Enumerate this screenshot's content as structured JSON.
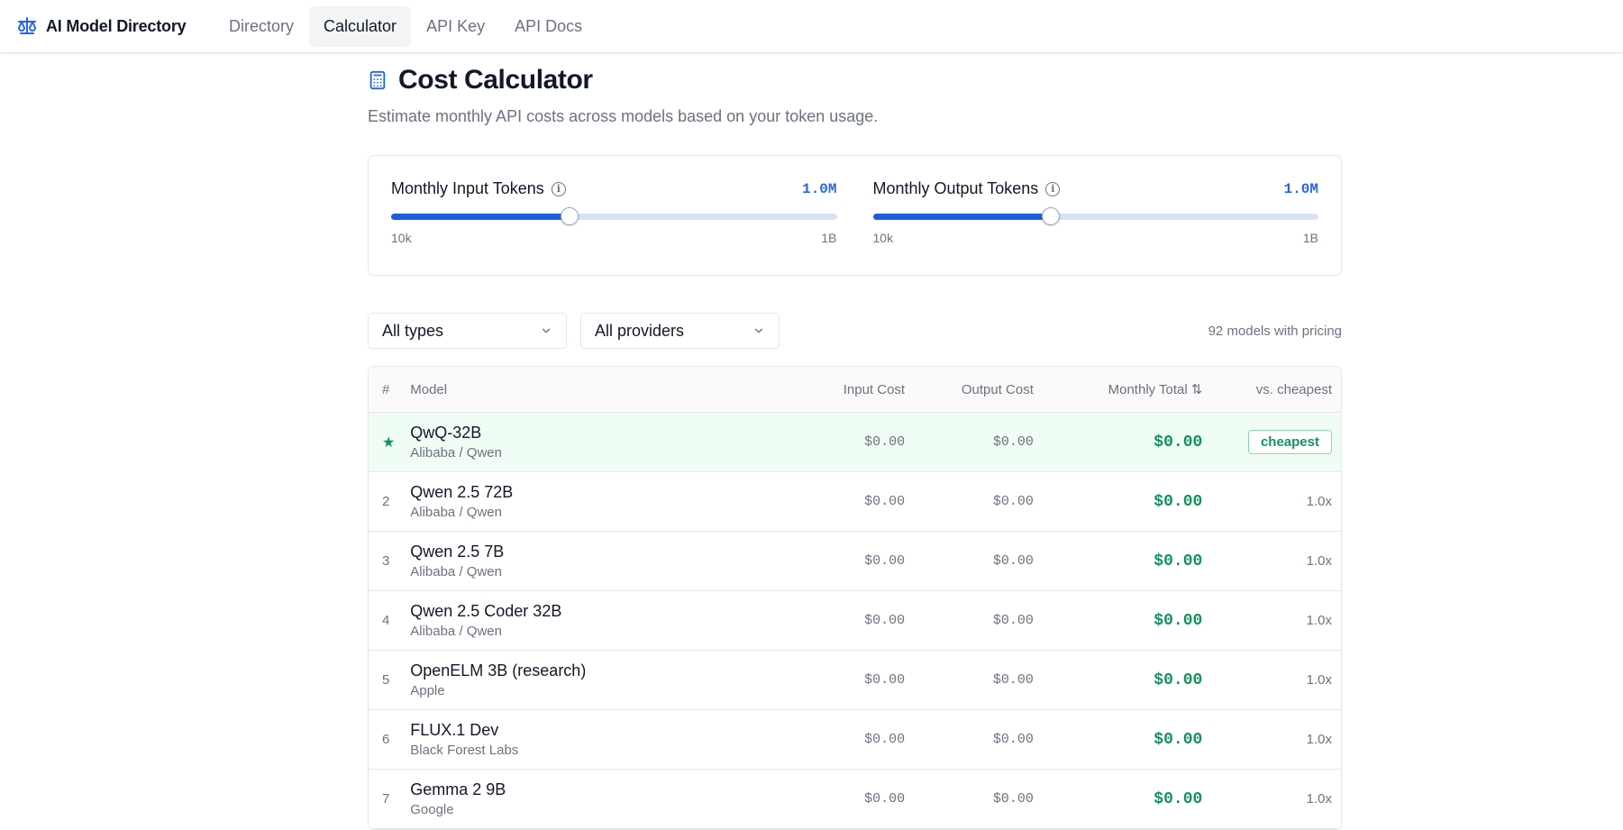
{
  "header": {
    "brand": "AI Model Directory",
    "nav": [
      {
        "label": "Directory",
        "active": false
      },
      {
        "label": "Calculator",
        "active": true
      },
      {
        "label": "API Key",
        "active": false
      },
      {
        "label": "API Docs",
        "active": false
      }
    ],
    "icon": "scale-icon"
  },
  "page": {
    "title": "Cost Calculator",
    "title_icon": "calculator-icon",
    "subtitle": "Estimate monthly API costs across models based on your token usage."
  },
  "sliders": {
    "input": {
      "label": "Monthly Input Tokens",
      "value": "1.0M",
      "min_label": "10k",
      "max_label": "1B",
      "fraction": 0.4
    },
    "output": {
      "label": "Monthly Output Tokens",
      "value": "1.0M",
      "min_label": "10k",
      "max_label": "1B",
      "fraction": 0.4
    }
  },
  "filters": {
    "type": "All types",
    "provider": "All providers",
    "count_text": "92 models with pricing"
  },
  "table": {
    "headers": {
      "num": "#",
      "model": "Model",
      "input": "Input Cost",
      "output": "Output Cost",
      "total": "Monthly Total",
      "vs": "vs. cheapest"
    },
    "rows": [
      {
        "rank": "★",
        "name": "QwQ-32B",
        "provider": "Alibaba / Qwen",
        "input": "$0.00",
        "output": "$0.00",
        "total": "$0.00",
        "vs": "cheapest"
      },
      {
        "rank": "2",
        "name": "Qwen 2.5 72B",
        "provider": "Alibaba / Qwen",
        "input": "$0.00",
        "output": "$0.00",
        "total": "$0.00",
        "vs": "1.0x"
      },
      {
        "rank": "3",
        "name": "Qwen 2.5 7B",
        "provider": "Alibaba / Qwen",
        "input": "$0.00",
        "output": "$0.00",
        "total": "$0.00",
        "vs": "1.0x"
      },
      {
        "rank": "4",
        "name": "Qwen 2.5 Coder 32B",
        "provider": "Alibaba / Qwen",
        "input": "$0.00",
        "output": "$0.00",
        "total": "$0.00",
        "vs": "1.0x"
      },
      {
        "rank": "5",
        "name": "OpenELM 3B (research)",
        "provider": "Apple",
        "input": "$0.00",
        "output": "$0.00",
        "total": "$0.00",
        "vs": "1.0x"
      },
      {
        "rank": "6",
        "name": "FLUX.1 Dev",
        "provider": "Black Forest Labs",
        "input": "$0.00",
        "output": "$0.00",
        "total": "$0.00",
        "vs": "1.0x"
      },
      {
        "rank": "7",
        "name": "Gemma 2 9B",
        "provider": "Google",
        "input": "$0.00",
        "output": "$0.00",
        "total": "$0.00",
        "vs": "1.0x"
      }
    ]
  },
  "colors": {
    "accent": "#2563eb",
    "success": "#15915b"
  }
}
